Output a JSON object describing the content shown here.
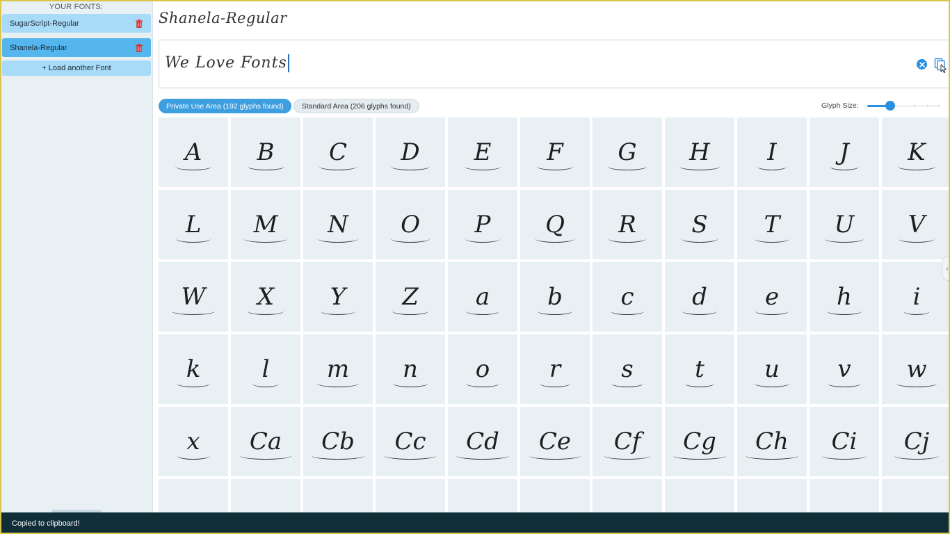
{
  "sidebar": {
    "title": "YOUR FONTS:",
    "fonts": [
      {
        "label": "SugarScript-Regular",
        "selected": false
      },
      {
        "label": "Shanela-Regular",
        "selected": true
      }
    ],
    "load_label": "+ Load another Font"
  },
  "main": {
    "font_name": "Shanela-Regular",
    "preview_text": "We Love Fonts",
    "tabs": [
      {
        "label": "Private Use Area (192 glyphs found)",
        "active": true
      },
      {
        "label": "Standard Area (206 glyphs found)",
        "active": false
      }
    ],
    "glyph_size_label": "Glyph Size:",
    "glyph_size_value": 0.33
  },
  "glyphs": [
    "A",
    "B",
    "C",
    "D",
    "E",
    "F",
    "G",
    "H",
    "I",
    "J",
    "K",
    "L",
    "M",
    "N",
    "O",
    "P",
    "Q",
    "R",
    "S",
    "T",
    "U",
    "V",
    "W",
    "X",
    "Y",
    "Z",
    "a",
    "b",
    "c",
    "d",
    "e",
    "h",
    "i",
    "k",
    "l",
    "m",
    "n",
    "o",
    "r",
    "s",
    "t",
    "u",
    "v",
    "w",
    "x",
    "Ca",
    "Cb",
    "Cc",
    "Cd",
    "Ce",
    "Cf",
    "Cg",
    "Ch",
    "Ci",
    "Cj",
    "",
    "",
    "",
    "",
    "",
    "",
    "",
    "",
    "",
    "",
    ""
  ],
  "toast": "Copied to clipboard!",
  "colors": {
    "accent": "#2a8fe0",
    "selected_item": "#55b6ee",
    "item": "#a8dbf7",
    "trash": "#d32f2f",
    "toast_bg": "#0f2e38"
  },
  "icons": {
    "trash": "trash-icon",
    "clear": "clear-circle-icon",
    "copy": "copy-icon",
    "handle": "chevron-left-icon"
  }
}
